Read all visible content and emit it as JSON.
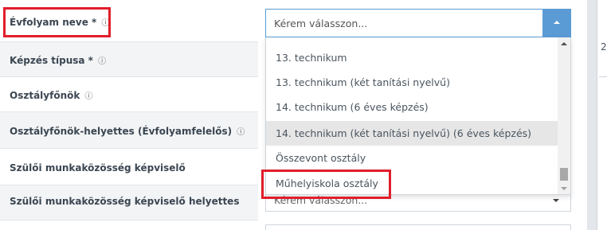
{
  "form": {
    "rows": [
      {
        "label": "Évfolyam neve *",
        "info_icon": "info-icon"
      },
      {
        "label": "Képzés típusa *",
        "info_icon": "info-icon"
      },
      {
        "label": "Osztályfőnök",
        "info_icon": "info-icon"
      },
      {
        "label": "Osztályfőnök-helyettes (Évfolyamfelelős)",
        "info_icon": "info-icon"
      },
      {
        "label": "Szülői munkaközösség képviselő"
      },
      {
        "label": "Szülői munkaközösség képviselő helyettes"
      }
    ],
    "info_glyph": "ⓘ"
  },
  "select_evfolyam": {
    "placeholder": "Kérem válasszon...",
    "options": [
      "13. technikum",
      "13. technikum (két tanítási nyelvű)",
      "14. technikum (6 éves képzés)",
      "14. technikum (két tanítási nyelvű) (6 éves képzés)",
      "Összevont osztály",
      "Műhelyiskola osztály"
    ],
    "hovered_option": "14. technikum (két tanítási nyelvű) (6 éves képzés)"
  },
  "select_helyettes": {
    "placeholder": "Kérem válasszon..."
  },
  "right_panel": {
    "partial_text": "2"
  },
  "colors": {
    "highlight": "#e11d2a",
    "accent": "#5b9bd5",
    "hover": "#e6e6e6"
  }
}
